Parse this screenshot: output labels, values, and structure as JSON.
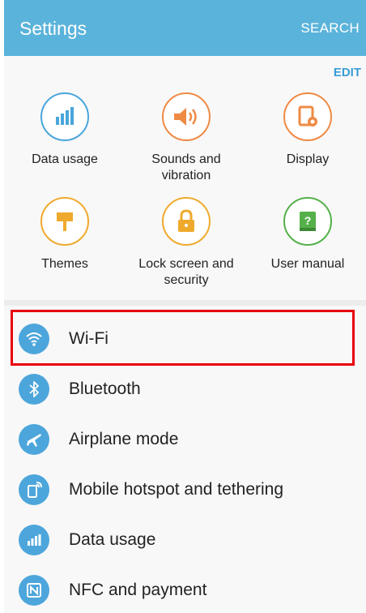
{
  "appbar": {
    "title": "Settings",
    "search": "SEARCH"
  },
  "quick": {
    "edit": "EDIT",
    "tiles": [
      {
        "label": "Data usage",
        "icon": "data-usage-icon",
        "color": "#4aa6dc"
      },
      {
        "label": "Sounds and vibration",
        "icon": "speaker-icon",
        "color": "#ef8a45"
      },
      {
        "label": "Display",
        "icon": "display-settings-icon",
        "color": "#ef8a45"
      },
      {
        "label": "Themes",
        "icon": "paintbrush-icon",
        "color": "#efaa2d"
      },
      {
        "label": "Lock screen and security",
        "icon": "lock-icon",
        "color": "#efaa2d"
      },
      {
        "label": "User manual",
        "icon": "book-icon",
        "color": "#55b04a"
      }
    ]
  },
  "list": [
    {
      "label": "Wi-Fi",
      "icon": "wifi-icon"
    },
    {
      "label": "Bluetooth",
      "icon": "bluetooth-icon"
    },
    {
      "label": "Airplane mode",
      "icon": "airplane-icon"
    },
    {
      "label": "Mobile hotspot and tethering",
      "icon": "hotspot-icon"
    },
    {
      "label": "Data usage",
      "icon": "data-usage-icon"
    },
    {
      "label": "NFC and payment",
      "icon": "nfc-icon"
    }
  ],
  "colors": {
    "appbar": "#5ab3da",
    "accent": "#3a9cd6",
    "list_icon": "#4da6db",
    "highlight": "#e8000b"
  }
}
